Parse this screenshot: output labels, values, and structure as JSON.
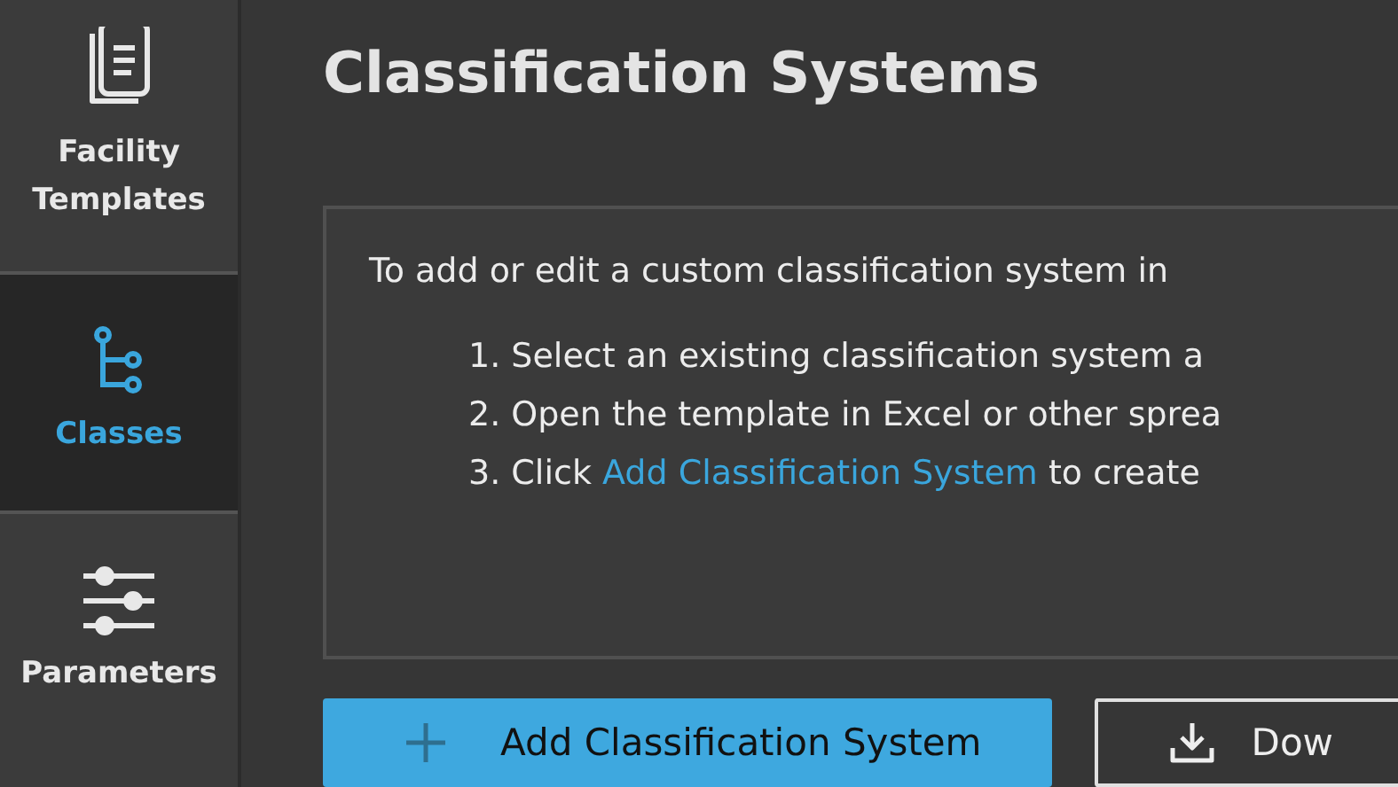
{
  "sidebar": {
    "items": [
      {
        "label": "Facility Templates",
        "kind": "clipboard",
        "selected": false
      },
      {
        "label": "Classes",
        "kind": "tree",
        "selected": true
      },
      {
        "label": "Parameters",
        "kind": "sliders",
        "selected": false
      }
    ]
  },
  "page": {
    "title": "Classification Systems",
    "intro": "To add or edit a custom classification system in",
    "steps": [
      {
        "number": "1.",
        "text": "Select an existing classification system a"
      },
      {
        "number": "2.",
        "text": "Open the template in Excel or other sprea"
      },
      {
        "number": "3.",
        "text": "Click",
        "link": "Add Classification System",
        "after": "to create"
      }
    ]
  },
  "buttons": [
    {
      "kind": "primary",
      "label": "Add Classification System"
    },
    {
      "kind": "secondary",
      "label": "Dow"
    }
  ]
}
